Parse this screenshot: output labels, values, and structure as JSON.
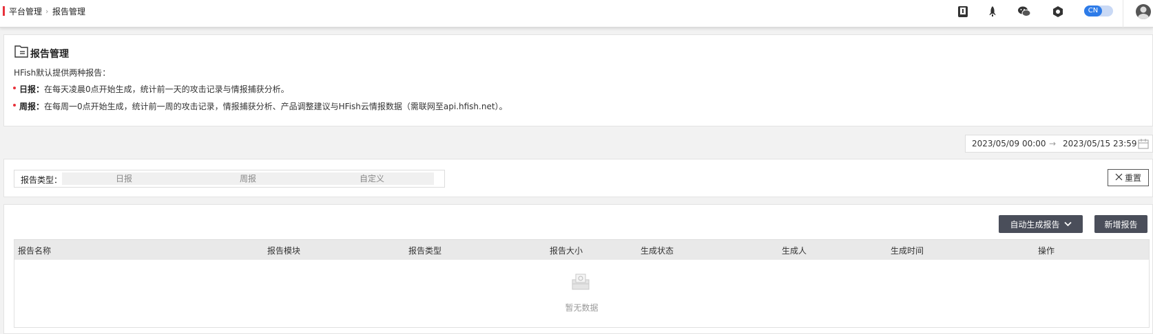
{
  "breadcrumb": {
    "parent": "平台管理",
    "separator": "›",
    "current": "报告管理"
  },
  "topbar": {
    "icons": [
      "book-icon",
      "rocket-icon",
      "wechat-icon",
      "hexagon-settings-icon"
    ],
    "lang_label": "CN",
    "accent_color": "#2d7be8"
  },
  "intro": {
    "title": "报告管理",
    "subtitle": "HFish默认提供两种报告：",
    "daily_label": "日报：",
    "daily_text": "在每天凌晨0点开始生成，统计前一天的攻击记录与情报捕获分析。",
    "weekly_label": "周报：",
    "weekly_text": "在每周一0点开始生成，统计前一周的攻击记录，情报捕获分析、产品调整建议与HFish云情报数据（需联网至api.hfish.net）。"
  },
  "date_range": {
    "start": "2023/05/09 00:00",
    "arrow": "→",
    "end": "2023/05/15 23:59"
  },
  "filter": {
    "label": "报告类型：",
    "options": [
      "日报",
      "周报",
      "自定义"
    ],
    "reset_label": "重置"
  },
  "actions": {
    "auto_generate_label": "自动生成报告",
    "add_label": "新增报告"
  },
  "table": {
    "columns": [
      "报告名称",
      "报告模块",
      "报告类型",
      "报告大小",
      "生成状态",
      "生成人",
      "生成时间",
      "操作"
    ],
    "rows": [],
    "empty_text": "暂无数据"
  }
}
